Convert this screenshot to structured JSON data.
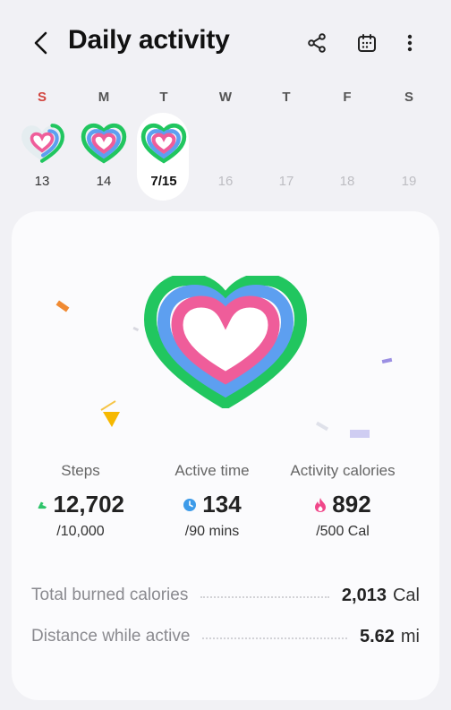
{
  "header": {
    "title": "Daily activity",
    "icons": [
      "back-icon",
      "share-icon",
      "calendar-icon",
      "more-options-icon"
    ]
  },
  "week": [
    {
      "name": "S",
      "date": "13"
    },
    {
      "name": "M",
      "date": "14"
    },
    {
      "name": "T",
      "date": "7/15"
    },
    {
      "name": "W",
      "date": "16"
    },
    {
      "name": "T",
      "date": "17"
    },
    {
      "name": "F",
      "date": "18"
    },
    {
      "name": "S",
      "date": "19"
    }
  ],
  "summary": {
    "steps": {
      "label": "Steps",
      "value": "12,702",
      "goal": "/10,000",
      "icon": "shoe-icon",
      "color": "#2ec46a"
    },
    "active_time": {
      "label": "Active time",
      "value": "134",
      "goal": "/90 mins",
      "icon": "clock-icon",
      "color": "#3d9be9"
    },
    "calories": {
      "label": "Activity calories",
      "value": "892",
      "goal": "/500 Cal",
      "icon": "flame-icon",
      "color": "#f0478a"
    }
  },
  "details": [
    {
      "label": "Total burned calories",
      "value": "2,013",
      "unit": "Cal"
    },
    {
      "label": "Distance while active",
      "value": "5.62",
      "unit": "mi"
    }
  ],
  "colors": {
    "steps_ring": "#21c65f",
    "active_ring": "#5d9ff0",
    "calories_ring": "#ef5d9a",
    "sunday": "#d2453f"
  }
}
